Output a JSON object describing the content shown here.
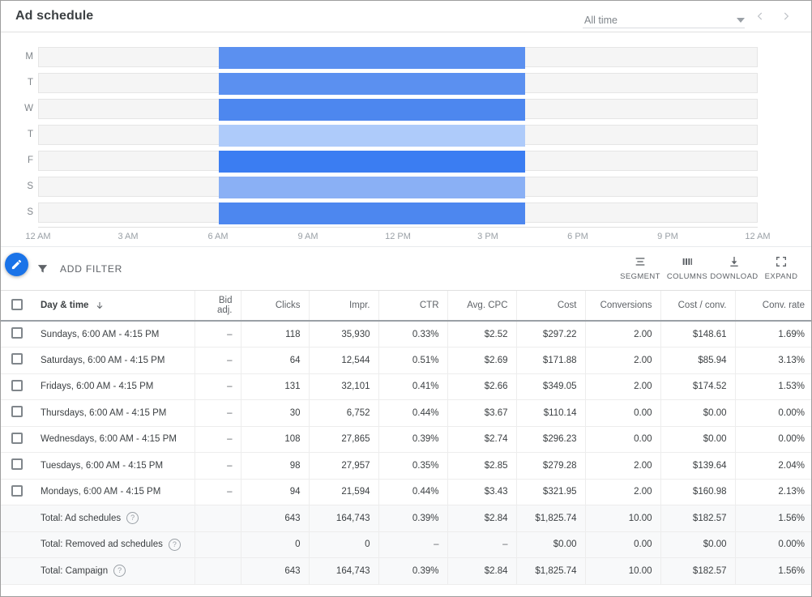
{
  "header": {
    "title": "Ad schedule",
    "date_range": "All time",
    "prev_icon": "chevron-left-icon",
    "next_icon": "chevron-right-icon",
    "dropdown_icon": "chevron-down-icon"
  },
  "chart_data": {
    "type": "bar",
    "title": "Ad schedule",
    "orientation": "horizontal",
    "xlabel": "",
    "ylabel": "",
    "grid": false,
    "legend": null,
    "xlim": [
      0,
      24
    ],
    "categories": [
      "M",
      "T",
      "W",
      "T",
      "F",
      "S",
      "S"
    ],
    "x_ticks": [
      "12 AM",
      "3 AM",
      "6 AM",
      "9 AM",
      "12 PM",
      "3 PM",
      "6 PM",
      "9 PM",
      "12 AM"
    ],
    "x_tick_values": [
      0,
      3,
      6,
      9,
      12,
      15,
      18,
      21,
      24
    ],
    "series": [
      {
        "name": "Monday",
        "label": "M",
        "start_hour": 6,
        "end_hour": 16.25,
        "color": "#5b90f0"
      },
      {
        "name": "Tuesday",
        "label": "T",
        "start_hour": 6,
        "end_hour": 16.25,
        "color": "#5b90f0"
      },
      {
        "name": "Wednesday",
        "label": "W",
        "start_hour": 6,
        "end_hour": 16.25,
        "color": "#4d87ef"
      },
      {
        "name": "Thursday",
        "label": "T",
        "start_hour": 6,
        "end_hour": 16.25,
        "color": "#aecbfa"
      },
      {
        "name": "Friday",
        "label": "F",
        "start_hour": 6,
        "end_hour": 16.25,
        "color": "#3b7df2"
      },
      {
        "name": "Saturday",
        "label": "S",
        "start_hour": 6,
        "end_hour": 16.25,
        "color": "#8ab0f5"
      },
      {
        "name": "Sunday",
        "label": "S",
        "start_hour": 6,
        "end_hour": 16.25,
        "color": "#4d87ef"
      }
    ],
    "track_color": "#f5f5f5"
  },
  "toolbar": {
    "filter_icon": "funnel-icon",
    "add_filter": "ADD FILTER",
    "actions": [
      {
        "label": "SEGMENT",
        "icon": "segment-icon"
      },
      {
        "label": "COLUMNS",
        "icon": "columns-icon"
      },
      {
        "label": "DOWNLOAD",
        "icon": "download-icon"
      },
      {
        "label": "EXPAND",
        "icon": "expand-icon"
      }
    ]
  },
  "fab": {
    "icon": "pencil-icon",
    "color": "#1a73e8"
  },
  "table": {
    "headers": {
      "day": "Day & time",
      "sort_icon": "arrow-down-icon",
      "bid_adj_line1": "Bid",
      "bid_adj_line2": "adj.",
      "clicks": "Clicks",
      "impr": "Impr.",
      "ctr": "CTR",
      "avg_cpc": "Avg. CPC",
      "cost": "Cost",
      "conversions": "Conversions",
      "cost_conv": "Cost / conv.",
      "conv_rate": "Conv. rate"
    },
    "rows": [
      {
        "day": "Sundays, 6:00 AM - 4:15 PM",
        "bid": "–",
        "clicks": "118",
        "impr": "35,930",
        "ctr": "0.33%",
        "cpc": "$2.52",
        "cost": "$297.22",
        "conv": "2.00",
        "cost_conv": "$148.61",
        "rate": "1.69%"
      },
      {
        "day": "Saturdays, 6:00 AM - 4:15 PM",
        "bid": "–",
        "clicks": "64",
        "impr": "12,544",
        "ctr": "0.51%",
        "cpc": "$2.69",
        "cost": "$171.88",
        "conv": "2.00",
        "cost_conv": "$85.94",
        "rate": "3.13%"
      },
      {
        "day": "Fridays, 6:00 AM - 4:15 PM",
        "bid": "–",
        "clicks": "131",
        "impr": "32,101",
        "ctr": "0.41%",
        "cpc": "$2.66",
        "cost": "$349.05",
        "conv": "2.00",
        "cost_conv": "$174.52",
        "rate": "1.53%"
      },
      {
        "day": "Thursdays, 6:00 AM - 4:15 PM",
        "bid": "–",
        "clicks": "30",
        "impr": "6,752",
        "ctr": "0.44%",
        "cpc": "$3.67",
        "cost": "$110.14",
        "conv": "0.00",
        "cost_conv": "$0.00",
        "rate": "0.00%"
      },
      {
        "day": "Wednesdays, 6:00 AM - 4:15 PM",
        "bid": "–",
        "clicks": "108",
        "impr": "27,865",
        "ctr": "0.39%",
        "cpc": "$2.74",
        "cost": "$296.23",
        "conv": "0.00",
        "cost_conv": "$0.00",
        "rate": "0.00%"
      },
      {
        "day": "Tuesdays, 6:00 AM - 4:15 PM",
        "bid": "–",
        "clicks": "98",
        "impr": "27,957",
        "ctr": "0.35%",
        "cpc": "$2.85",
        "cost": "$279.28",
        "conv": "2.00",
        "cost_conv": "$139.64",
        "rate": "2.04%"
      },
      {
        "day": "Mondays, 6:00 AM - 4:15 PM",
        "bid": "–",
        "clicks": "94",
        "impr": "21,594",
        "ctr": "0.44%",
        "cpc": "$3.43",
        "cost": "$321.95",
        "conv": "2.00",
        "cost_conv": "$160.98",
        "rate": "2.13%"
      }
    ],
    "totals": [
      {
        "day": "Total: Ad schedules",
        "bid": "",
        "clicks": "643",
        "impr": "164,743",
        "ctr": "0.39%",
        "cpc": "$2.84",
        "cost": "$1,825.74",
        "conv": "10.00",
        "cost_conv": "$182.57",
        "rate": "1.56%"
      },
      {
        "day": "Total: Removed ad schedules",
        "bid": "",
        "clicks": "0",
        "impr": "0",
        "ctr": "–",
        "cpc": "–",
        "cost": "$0.00",
        "conv": "0.00",
        "cost_conv": "$0.00",
        "rate": "0.00%"
      },
      {
        "day": "Total: Campaign",
        "bid": "",
        "clicks": "643",
        "impr": "164,743",
        "ctr": "0.39%",
        "cpc": "$2.84",
        "cost": "$1,825.74",
        "conv": "10.00",
        "cost_conv": "$182.57",
        "rate": "1.56%"
      }
    ]
  }
}
